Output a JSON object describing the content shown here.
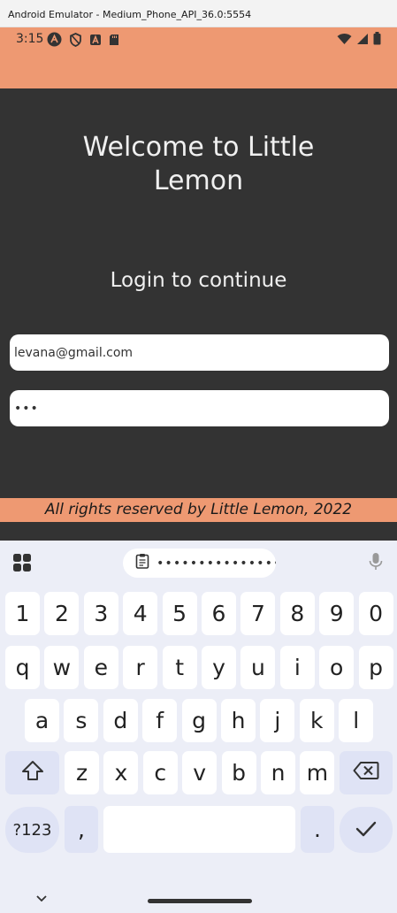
{
  "window": {
    "title": "Android Emulator - Medium_Phone_API_36.0:5554"
  },
  "status_bar": {
    "time": "3:15",
    "left_icons": [
      "a-circle-icon",
      "shield-icon",
      "a-square-icon",
      "sd-card-icon"
    ],
    "right_icons": [
      "wifi-icon",
      "signal-icon",
      "battery-icon"
    ],
    "background": "#ee9972"
  },
  "app": {
    "welcome_title": "Welcome to Little Lemon",
    "login_subtitle": "Login to continue",
    "email": {
      "value": "levana@gmail.com"
    },
    "password": {
      "value": "•••"
    },
    "footer": "All rights reserved by Little Lemon, 2022",
    "colors": {
      "body": "#333333",
      "accent": "#ee9972"
    }
  },
  "keyboard": {
    "clipboard_text": "•••••••••••••••••••",
    "number_row": [
      "1",
      "2",
      "3",
      "4",
      "5",
      "6",
      "7",
      "8",
      "9",
      "0"
    ],
    "row1": [
      "q",
      "w",
      "e",
      "r",
      "t",
      "y",
      "u",
      "i",
      "o",
      "p"
    ],
    "row2": [
      "a",
      "s",
      "d",
      "f",
      "g",
      "h",
      "j",
      "k",
      "l"
    ],
    "row3": [
      "z",
      "x",
      "c",
      "v",
      "b",
      "n",
      "m"
    ],
    "symbols_label": "?123",
    "comma_label": ",",
    "period_label": ".",
    "icons": [
      "apps-grid-icon",
      "clipboard-icon",
      "mic-icon",
      "shift-icon",
      "backspace-icon",
      "enter-check-icon",
      "nav-chevron-down-icon"
    ]
  }
}
